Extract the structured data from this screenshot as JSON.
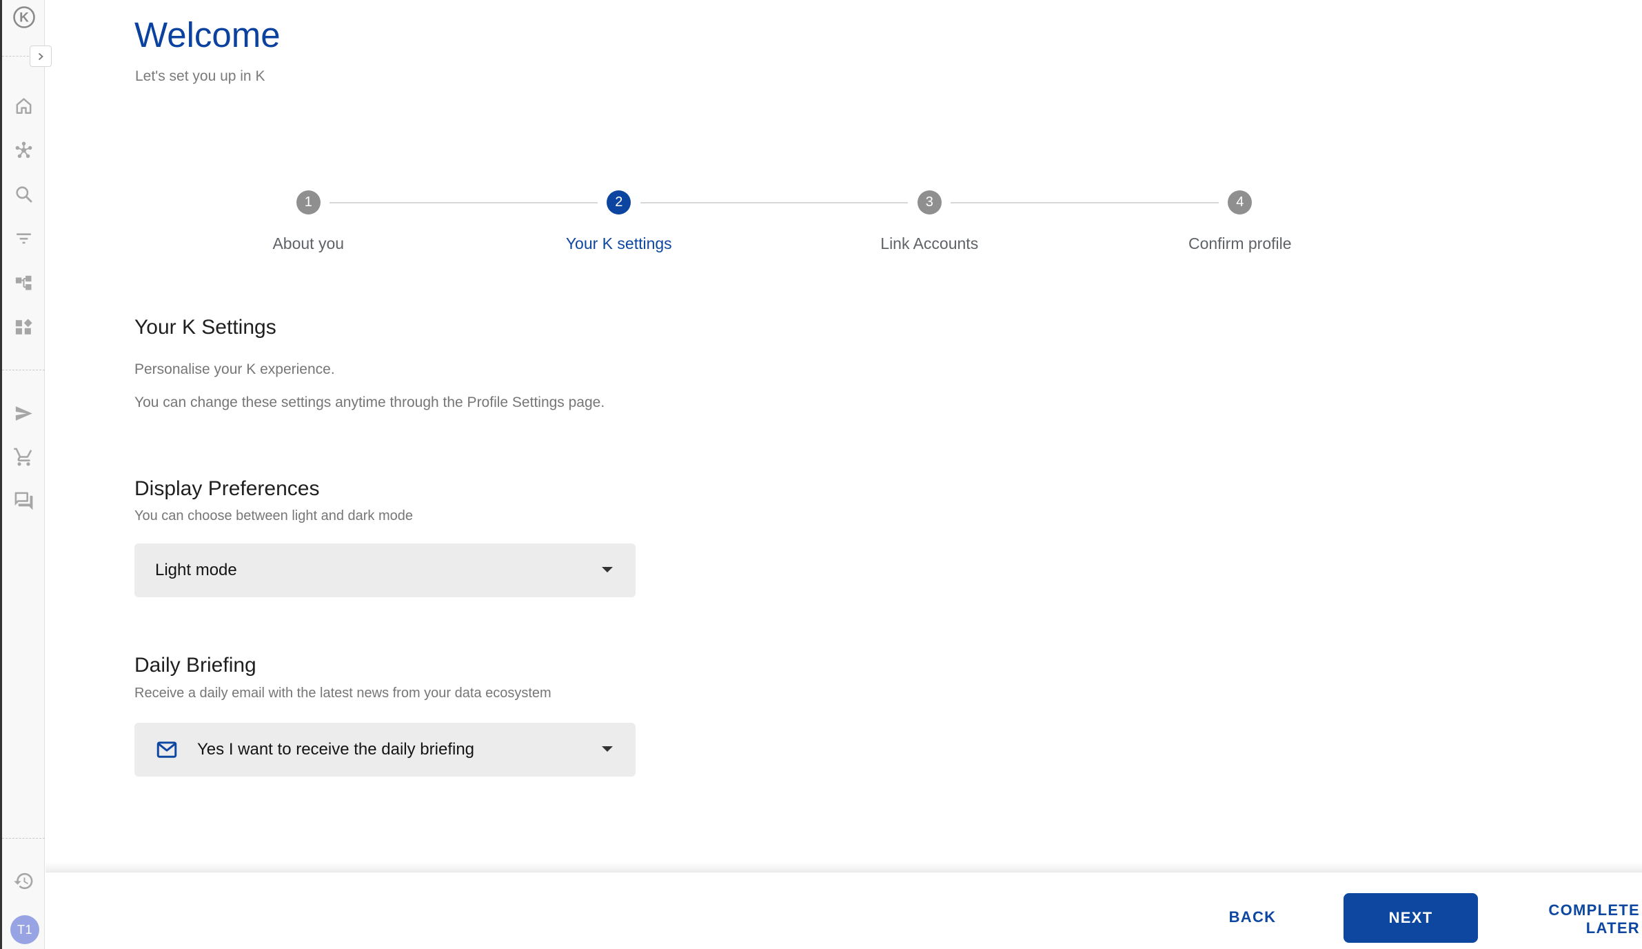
{
  "app": {
    "logo_letter": "K"
  },
  "colors": {
    "primary_blue": "#0d47a1",
    "title_blue": "#0b429f",
    "inactive_step_gray": "#8f8f8f",
    "body_text_gray": "#767676",
    "heading_black": "#1f1f1f",
    "select_background": "#ececec",
    "avatar_background": "#97a3e2",
    "sidebar_background": "#f8f8f8"
  },
  "sidebar": {
    "icons": [
      "k-logo",
      "expand",
      "home",
      "hub",
      "search",
      "filter",
      "tree",
      "dashboard",
      "send",
      "shopping-cart",
      "chat",
      "history"
    ],
    "avatar_initials": "T1"
  },
  "header": {
    "title": "Welcome",
    "subtitle": "Let's set you up in K"
  },
  "stepper": {
    "steps": [
      {
        "number": "1",
        "label": "About you",
        "state": "inactive"
      },
      {
        "number": "2",
        "label": "Your K settings",
        "state": "active"
      },
      {
        "number": "3",
        "label": "Link Accounts",
        "state": "inactive"
      },
      {
        "number": "4",
        "label": "Confirm profile",
        "state": "inactive"
      }
    ]
  },
  "settings": {
    "heading": "Your K Settings",
    "description_line1": "Personalise your K experience.",
    "description_line2": "You can change these settings anytime through the Profile Settings page.",
    "display_preferences": {
      "heading": "Display Preferences",
      "description": "You can choose between light and dark mode",
      "selected_value": "Light mode"
    },
    "daily_briefing": {
      "heading": "Daily Briefing",
      "description": "Receive a daily email with the latest news from your data ecosystem",
      "selected_value": "Yes I want to receive the daily briefing"
    }
  },
  "footer": {
    "back_label": "BACK",
    "next_label": "NEXT",
    "complete_later_label": "COMPLETE LATER"
  }
}
